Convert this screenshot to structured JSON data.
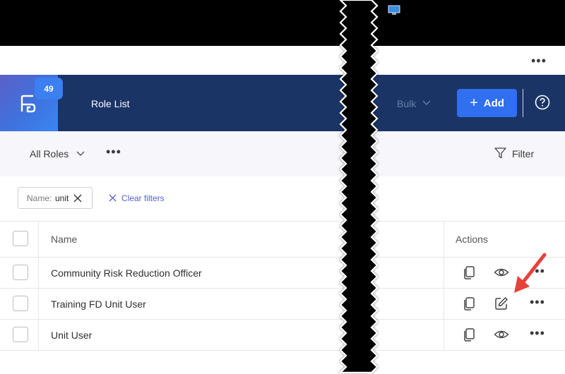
{
  "header": {
    "badge_count": "49",
    "page_title": "Role List",
    "bulk_label": "Bulk",
    "add_label": "Add",
    "accent_color": "#2f6ff0",
    "header_color": "#1a3466"
  },
  "toolbar": {
    "view_label": "All Roles",
    "filter_label": "Filter"
  },
  "filters": {
    "chip_key": "Name:",
    "chip_value": "unit",
    "clear_label": "Clear filters"
  },
  "table": {
    "columns": [
      "Name",
      "Actions"
    ],
    "rows": [
      {
        "name": "Community Risk Reduction Officer",
        "middle_action": "view"
      },
      {
        "name": "Training FD Unit User",
        "middle_action": "edit"
      },
      {
        "name": "Unit User",
        "middle_action": "view"
      }
    ]
  },
  "icons": {
    "logo": "app-logo-icon",
    "copy": "copy-icon",
    "view": "eye-icon",
    "edit": "edit-icon",
    "help": "help-icon",
    "filter": "filter-icon"
  },
  "annotation": {
    "arrow_color": "#e8403a"
  }
}
